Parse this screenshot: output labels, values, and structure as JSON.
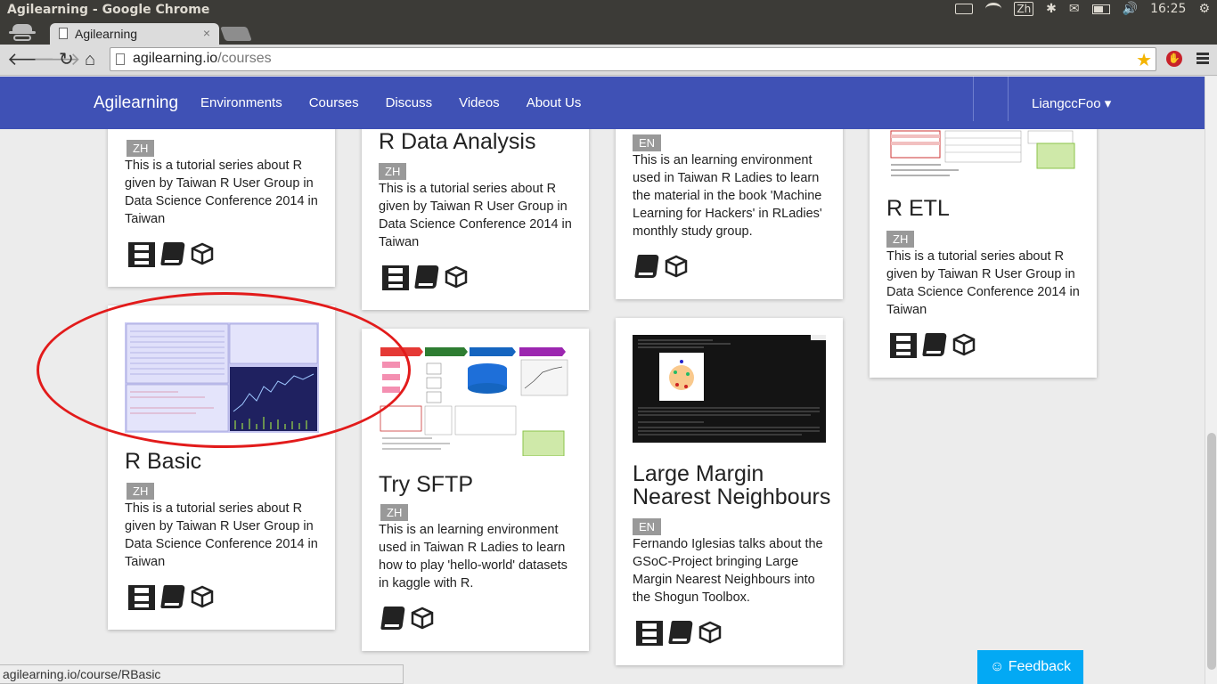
{
  "os": {
    "window_title": "Agilearning - Google Chrome",
    "ime": "Zh",
    "clock": "16:25"
  },
  "browser": {
    "tab_title": "Agilearning",
    "tab_close": "×",
    "url_host": "agilearning.io",
    "url_path": "/courses",
    "status_url": "agilearning.io/course/RBasic"
  },
  "site": {
    "brand": "Agilearning",
    "nav": [
      "Environments",
      "Courses",
      "Discuss",
      "Videos",
      "About Us"
    ],
    "user": "LiangccFoo ▾",
    "feedback": "☺ Feedback"
  },
  "cards": [
    {
      "title": "",
      "lang": "ZH",
      "desc": "This is a tutorial series about R given by Taiwan R User Group in Data Science Conference 2014 in Taiwan",
      "icons": [
        "film-icon",
        "book-icon",
        "box-icon"
      ]
    },
    {
      "title": "R Data Analysis",
      "lang": "ZH",
      "desc": "This is a tutorial series about R given by Taiwan R User Group in Data Science Conference 2014 in Taiwan",
      "icons": [
        "film-icon",
        "book-icon",
        "box-icon"
      ]
    },
    {
      "title": "",
      "lang": "EN",
      "desc": "This is an learning environment used in Taiwan R Ladies to learn the material in the book 'Machine Learning for Hackers' in RLadies' monthly study group.",
      "icons": [
        "book-icon",
        "box-icon"
      ]
    },
    {
      "title": "R ETL",
      "lang": "ZH",
      "desc": "This is a tutorial series about R given by Taiwan R User Group in Data Science Conference 2014 in Taiwan",
      "icons": [
        "film-icon",
        "book-icon",
        "box-icon"
      ]
    },
    {
      "title": "R Basic",
      "lang": "ZH",
      "desc": "This is a tutorial series about R given by Taiwan R User Group in Data Science Conference 2014 in Taiwan",
      "icons": [
        "film-icon",
        "book-icon",
        "box-icon"
      ]
    },
    {
      "title": "Try SFTP",
      "lang": "ZH",
      "desc": "This is an learning environment used in Taiwan R Ladies to learn how to play 'hello-world' datasets in kaggle with R.",
      "icons": [
        "book-icon",
        "box-icon"
      ]
    },
    {
      "title": "Large Margin Nearest Neighbours",
      "lang": "EN",
      "desc": "Fernando Iglesias talks about the GSoC-Project bringing Large Margin Nearest Neighbours into the Shogun Toolbox.",
      "icons": [
        "film-icon",
        "book-icon",
        "box-icon"
      ]
    }
  ],
  "colors": {
    "navbar": "#3f51b5",
    "feedback": "#03a9f4",
    "highlight": "#e21b1b",
    "badge": "#999999"
  }
}
